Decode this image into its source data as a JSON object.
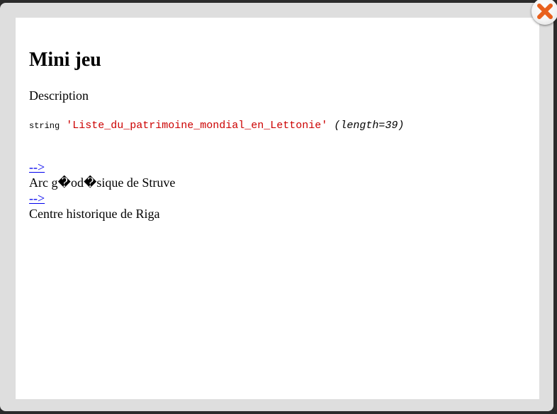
{
  "modal": {
    "title": "Mini jeu",
    "description": "Description",
    "debug": {
      "type": "string",
      "value": "'Liste_du_patrimoine_mondial_en_Lettonie'",
      "length": "(length=39)"
    },
    "items": [
      {
        "link": "-->",
        "label": "Arc g�od�sique de Struve"
      },
      {
        "link": "-->",
        "label": "Centre historique de Riga"
      }
    ]
  },
  "colors": {
    "frame": "#dedede",
    "content": "#ffffff",
    "link": "#0000ee",
    "string_value": "#cc0000",
    "close_icon": "#e8601c"
  },
  "icons": {
    "close": "close-icon"
  }
}
